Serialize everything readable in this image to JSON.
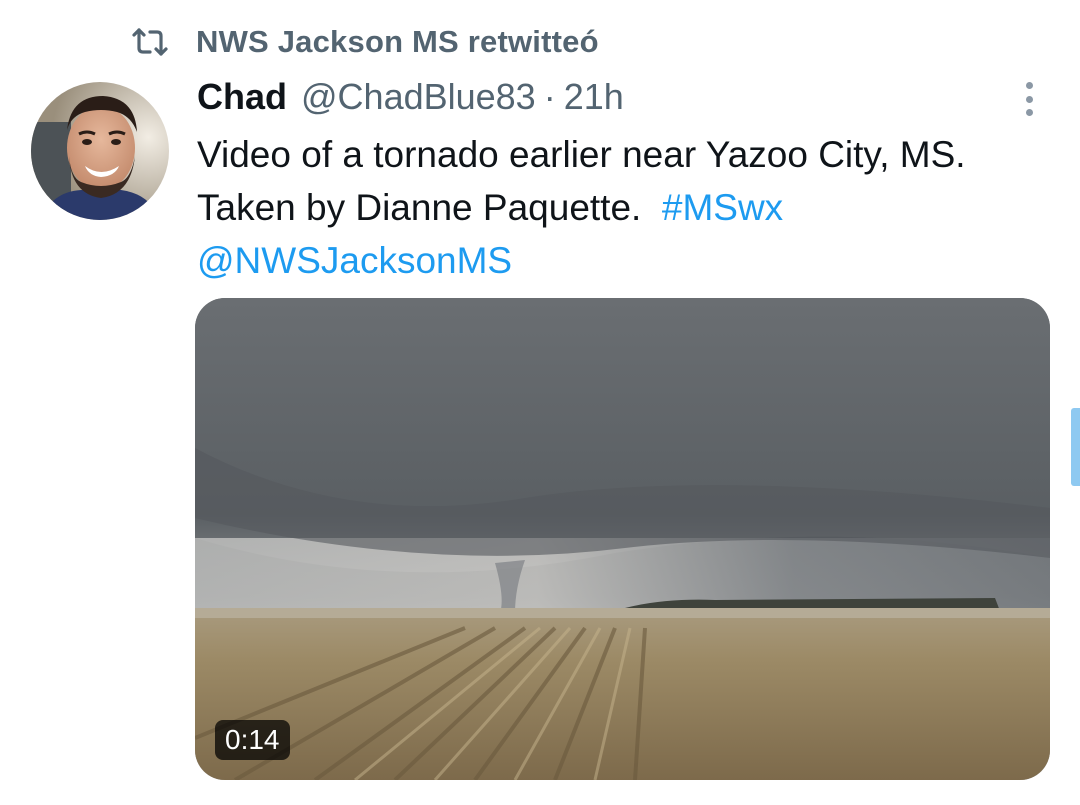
{
  "retweet": {
    "icon": "retweet-icon",
    "text": "NWS Jackson MS retwitteó"
  },
  "tweet": {
    "display_name": "Chad",
    "handle": "@ChadBlue83",
    "separator": "·",
    "time": "21h",
    "text_line1": "Video of a tornado earlier near Yazoo City, MS.",
    "text_line2_plain": "Taken by Dianne Paquette.",
    "hashtag": "#MSwx",
    "mention": "@NWSJacksonMS",
    "more_icon": "more-vertical-icon"
  },
  "media": {
    "duration": "0:14"
  },
  "colors": {
    "text": "#0f1419",
    "secondary": "#536471",
    "link": "#1d9bf0"
  }
}
